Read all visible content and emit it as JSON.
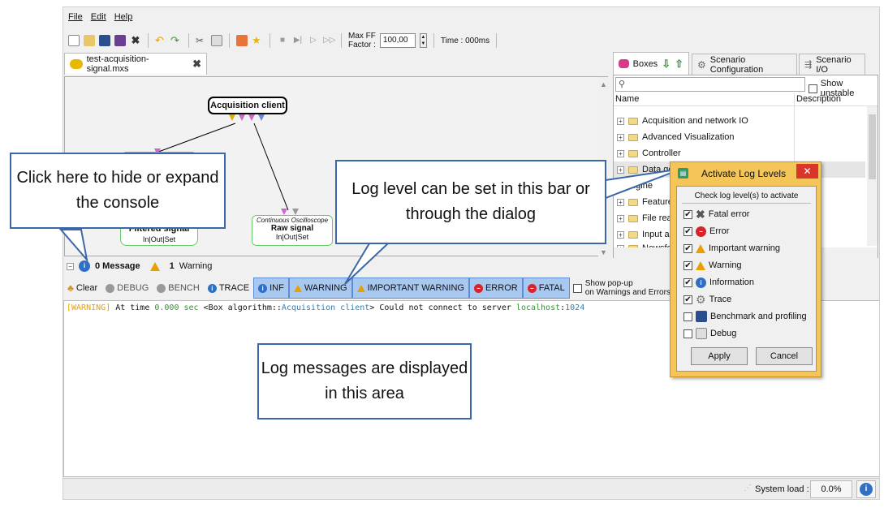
{
  "menu": [
    "File",
    "Edit",
    "Help"
  ],
  "toolbar": {
    "maxff_label_1": "Max FF",
    "maxff_label_2": "Factor :",
    "maxff_value": "100,00",
    "time": "Time : 000ms"
  },
  "scenario_tab": {
    "label": "test-acquisition-signal.mxs"
  },
  "canvas": {
    "acquisition_box": "Acquisition client",
    "filtered_title": "Filtered signal",
    "filtered_ports": "In|Out|Set",
    "osc_subtitle": "Continuous Oscilloscope",
    "osc_title": "Raw signal",
    "osc_ports": "In|Out|Set"
  },
  "right_panel": {
    "tabs": [
      "Boxes",
      "Scenario Configuration",
      "Scenario I/O"
    ],
    "show_unstable": "Show unstable",
    "columns": [
      "Name",
      "Description"
    ],
    "tree": [
      "Acquisition and network IO",
      "Advanced Visualization",
      "Controller",
      "Data generation",
      "...gine",
      "Feature E...",
      "File readi...",
      "Input and...",
      "Newsfe..."
    ]
  },
  "console_bar": {
    "messages": "0 Message",
    "warnings_count": "1",
    "warnings_label": "Warning"
  },
  "log_bar": {
    "clear": "Clear",
    "debug": "DEBUG",
    "bench": "BENCH",
    "trace": "TRACE",
    "inf": "INF",
    "warning": "WARNING",
    "important": "IMPORTANT WARNING",
    "error": "ERROR",
    "fatal": "FATAL",
    "popup_1": "Show pop-up",
    "popup_2": "on Warnings and Errors"
  },
  "console_log": {
    "tag": "[WARNING]",
    "p1": " At time ",
    "time": "0.000 sec",
    "p2": " <Box algorithm::",
    "box": "Acquisition client",
    "p3": "> Could not connect to server ",
    "host": "localhost",
    "p4": ":",
    "port": "1024"
  },
  "status_bar": {
    "label": "System load :",
    "value": "0.0%"
  },
  "dialog": {
    "title": "Activate Log Levels",
    "heading": "Check log level(s) to activate",
    "items": [
      {
        "label": "Fatal error",
        "checked": true
      },
      {
        "label": "Error",
        "checked": true
      },
      {
        "label": "Important warning",
        "checked": true
      },
      {
        "label": "Warning",
        "checked": true
      },
      {
        "label": "Information",
        "checked": true
      },
      {
        "label": "Trace",
        "checked": true
      },
      {
        "label": "Benchmark and profiling",
        "checked": false
      },
      {
        "label": "Debug",
        "checked": false
      }
    ],
    "apply": "Apply",
    "cancel": "Cancel"
  },
  "callouts": {
    "console": "Click here to hide or expand the console",
    "loglevel": "Log level can be set in this bar or through the dialog",
    "logarea": "Log messages are displayed in this area"
  },
  "colors": {
    "accent": "#3b67a8",
    "warning": "#e8a000",
    "error": "#d9232a",
    "info": "#2f6fc4",
    "dialog_frame": "#f4c65a"
  }
}
